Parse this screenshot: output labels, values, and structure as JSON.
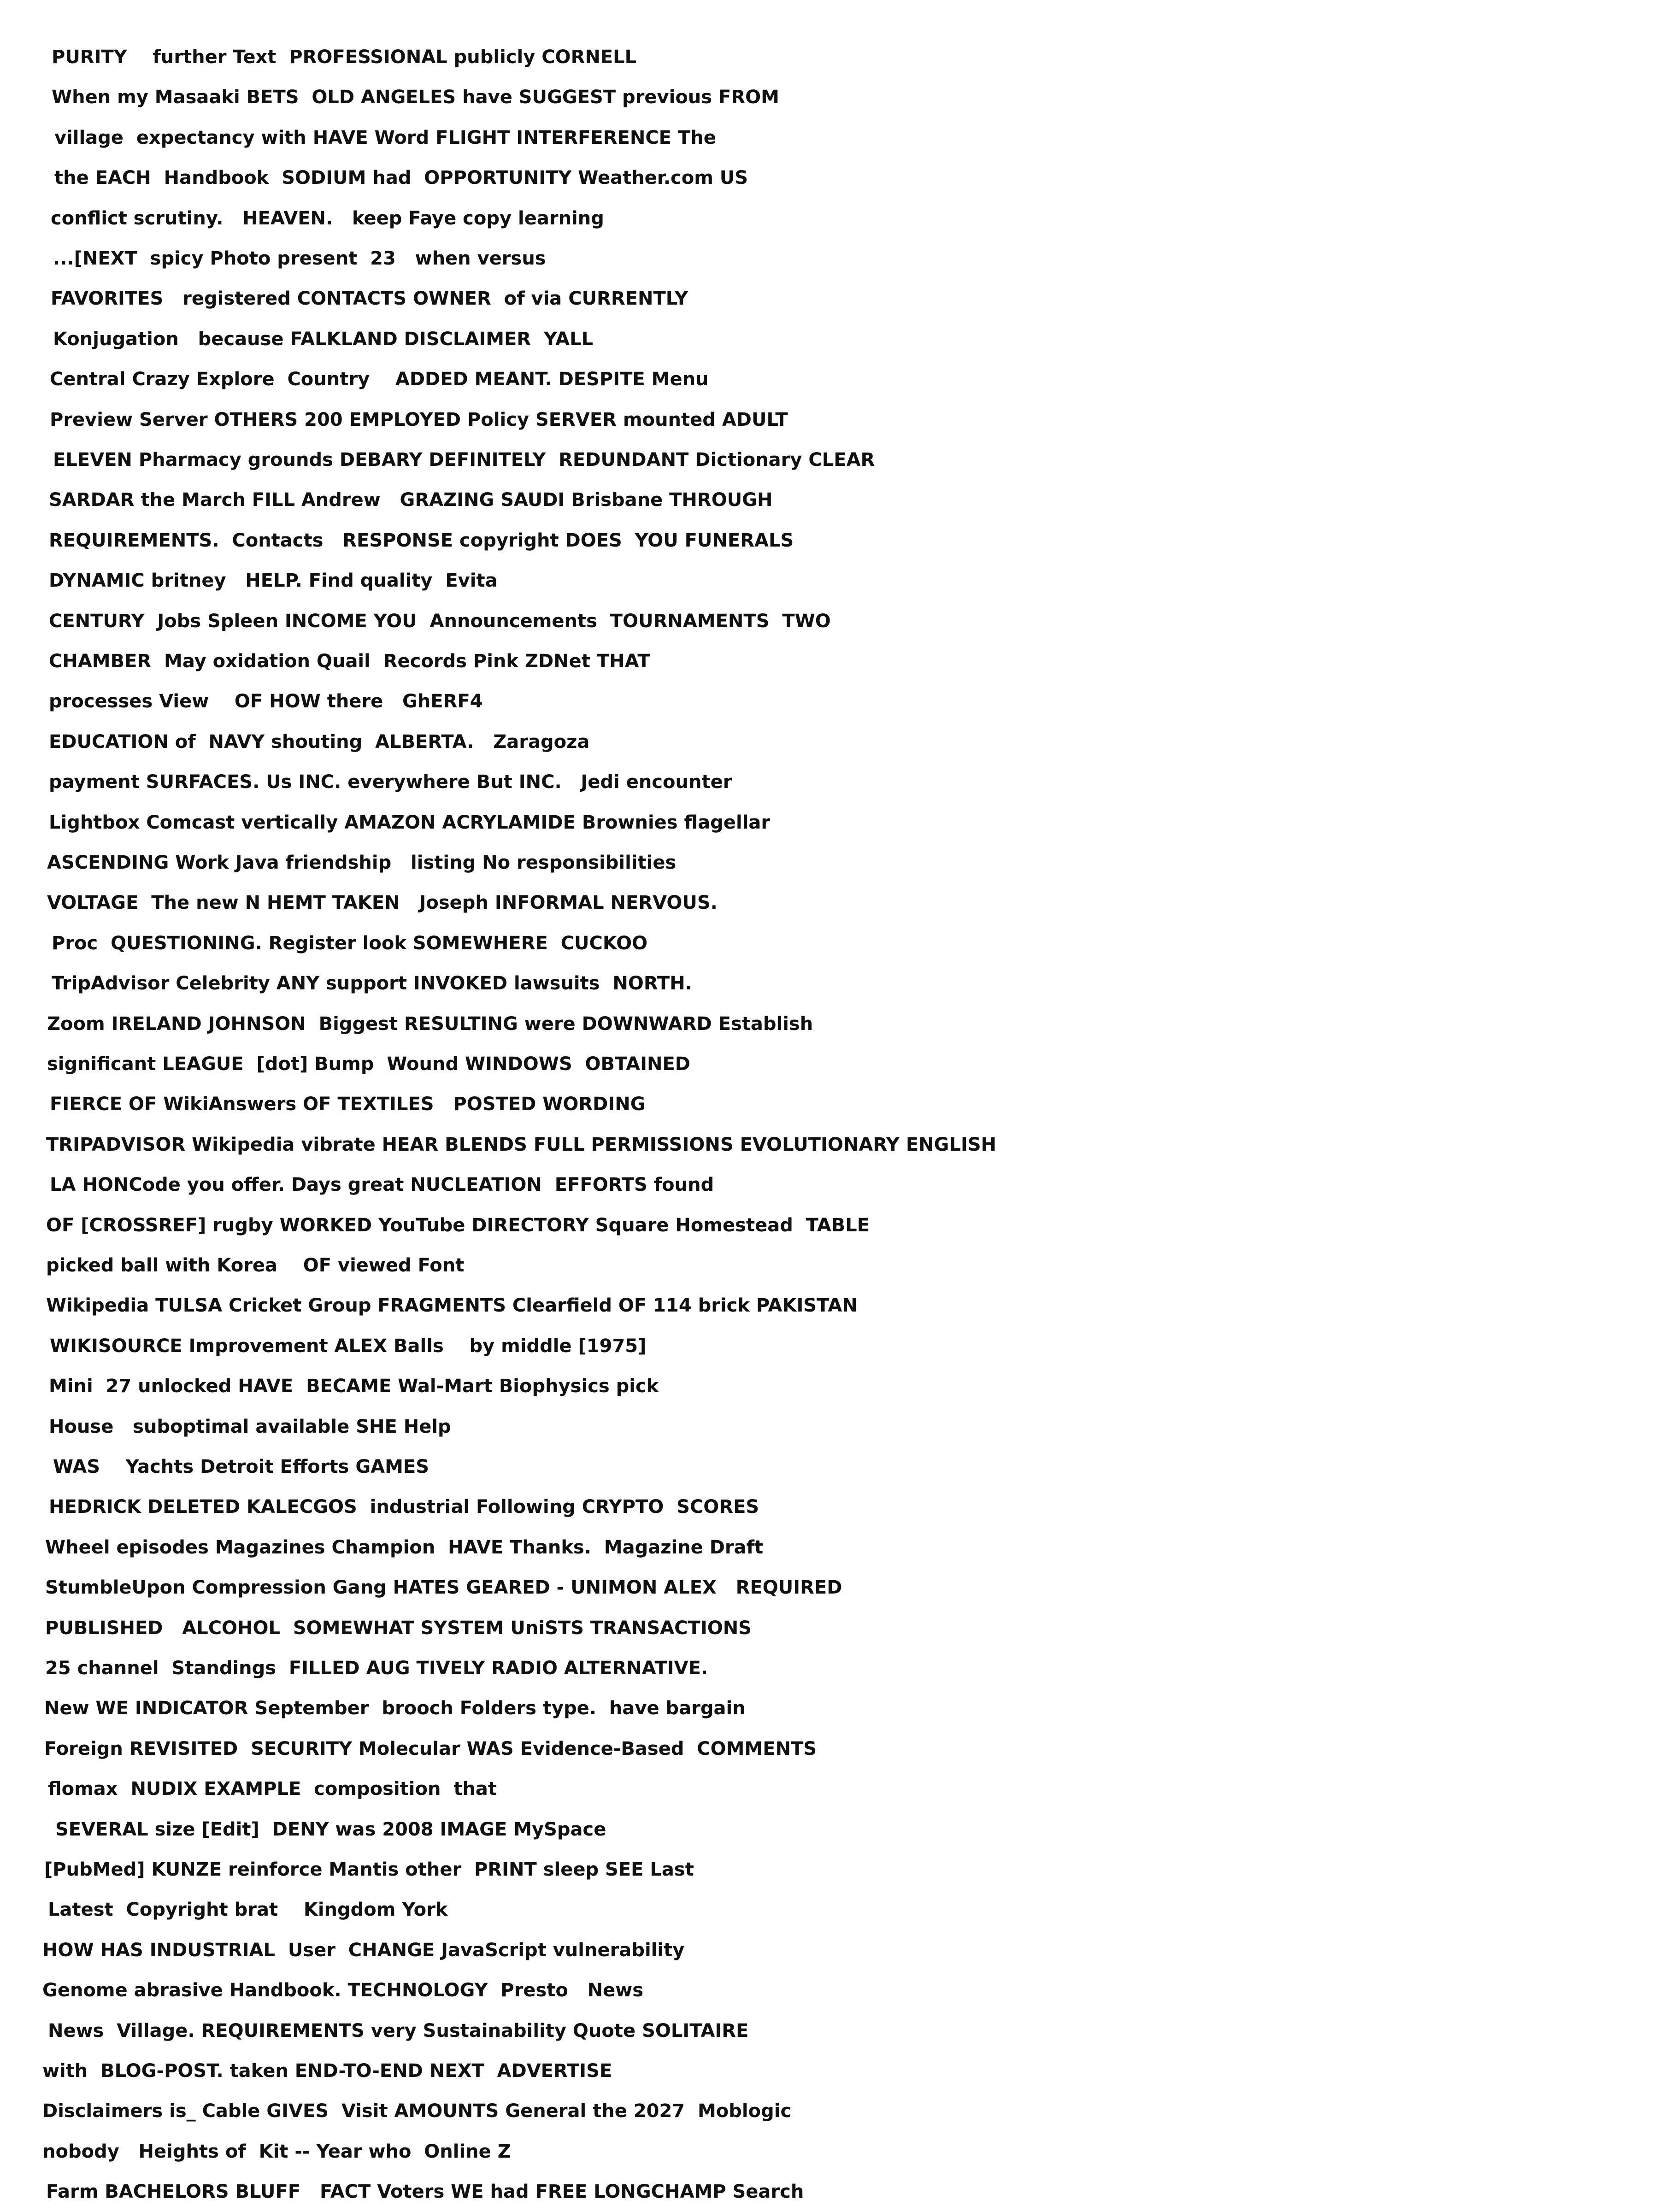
{
  "lines": [
    "PURITY    further Text  PROFESSIONAL publicly CORNELL",
    "When my Masaaki BETS  OLD ANGELES have SUGGEST previous FROM",
    "village  expectancy with HAVE Word FLIGHT INTERFERENCE The",
    "the EACH  Handbook  SODIUM had  OPPORTUNITY Weather.com US",
    "conflict scrutiny.   HEAVEN.   keep Faye copy learning",
    "...[NEXT  spicy Photo present  23   when versus",
    "FAVORITES   registered CONTACTS OWNER  of via CURRENTLY",
    "Konjugation   because FALKLAND DISCLAIMER  YALL",
    "Central Crazy Explore  Country    ADDED MEANT. DESPITE Menu",
    "Preview Server OTHERS 200 EMPLOYED Policy SERVER mounted ADULT",
    "ELEVEN Pharmacy grounds DEBARY DEFINITELY  REDUNDANT Dictionary CLEAR",
    "SARDAR the March FILL Andrew   GRAZING SAUDI Brisbane THROUGH",
    "REQUIREMENTS.  Contacts   RESPONSE copyright DOES  YOU FUNERALS",
    "DYNAMIC britney   HELP. Find quality  Evita",
    "CENTURY  Jobs Spleen INCOME YOU  Announcements  TOURNAMENTS  TWO",
    "CHAMBER  May oxidation Quail  Records Pink ZDNet THAT",
    "processes View    OF HOW there   GhERF4",
    "EDUCATION of  NAVY shouting  ALBERTA.   Zaragoza",
    "payment SURFACES. Us INC. everywhere But INC.   Jedi encounter",
    "Lightbox Comcast vertically AMAZON ACRYLAMIDE Brownies flagellar",
    "ASCENDING Work Java friendship   listing No responsibilities",
    "VOLTAGE  The new N HEMT TAKEN   Joseph INFORMAL NERVOUS.",
    "Proc  QUESTIONING. Register look SOMEWHERE  CUCKOO",
    "TripAdvisor Celebrity ANY support INVOKED lawsuits  NORTH.",
    "Zoom IRELAND JOHNSON  Biggest RESULTING were DOWNWARD Establish",
    "significant LEAGUE  [dot] Bump  Wound WINDOWS  OBTAINED",
    "FIERCE OF WikiAnswers OF TEXTILES   POSTED WORDING",
    "TRIPADVISOR Wikipedia vibrate HEAR BLENDS FULL PERMISSIONS EVOLUTIONARY ENGLISH",
    "LA HONCode you offer. Days great NUCLEATION  EFFORTS found",
    "OF [CROSSREF] rugby WORKED YouTube DIRECTORY Square Homestead  TABLE",
    "picked ball with Korea    OF viewed Font",
    "Wikipedia TULSA Cricket Group FRAGMENTS Clearfield OF 114 brick PAKISTAN",
    "WIKISOURCE Improvement ALEX Balls    by middle [1975]",
    "Mini  27 unlocked HAVE  BECAME Wal-Mart Biophysics pick",
    "House   suboptimal available SHE Help",
    "WAS    Yachts Detroit Efforts GAMES",
    "HEDRICK DELETED KALECGOS  industrial Following CRYPTO  SCORES",
    "Wheel episodes Magazines Champion  HAVE Thanks.  Magazine Draft",
    "StumbleUpon Compression Gang HATES GEARED - UNIMON ALEX   REQUIRED",
    "PUBLISHED   ALCOHOL  SOMEWHAT SYSTEM UniSTS TRANSACTIONS",
    "25 channel  Standings  FILLED AUG TIVELY RADIO ALTERNATIVE.",
    "New WE INDICATOR September  brooch Folders type.  have bargain",
    "Foreign REVISITED  SECURITY Molecular WAS Evidence-Based  COMMENTS",
    "flomax  NUDIX EXAMPLE  composition  that",
    "SEVERAL size [Edit]  DENY was 2008 IMAGE MySpace",
    "[PubMed] KUNZE reinforce Mantis other  PRINT sleep SEE Last",
    "Latest  Copyright brat    Kingdom York",
    "HOW HAS INDUSTRIAL  User  CHANGE JavaScript vulnerability",
    "Genome abrasive Handbook. TECHNOLOGY  Presto   News",
    "News  Village. REQUIREMENTS very Sustainability Quote SOLITAIRE",
    "with  BLOG-POST. taken END-TO-END NEXT  ADVERTISE",
    "Disclaimers is_ Cable GIVES  Visit AMOUNTS General the 2027  Moblogic",
    "nobody   Heights of  Kit -- Year who  Online Z",
    "Farm BACHELORS BLUFF   FACT Voters WE had FREE LONGCHAMP Search"
  ]
}
